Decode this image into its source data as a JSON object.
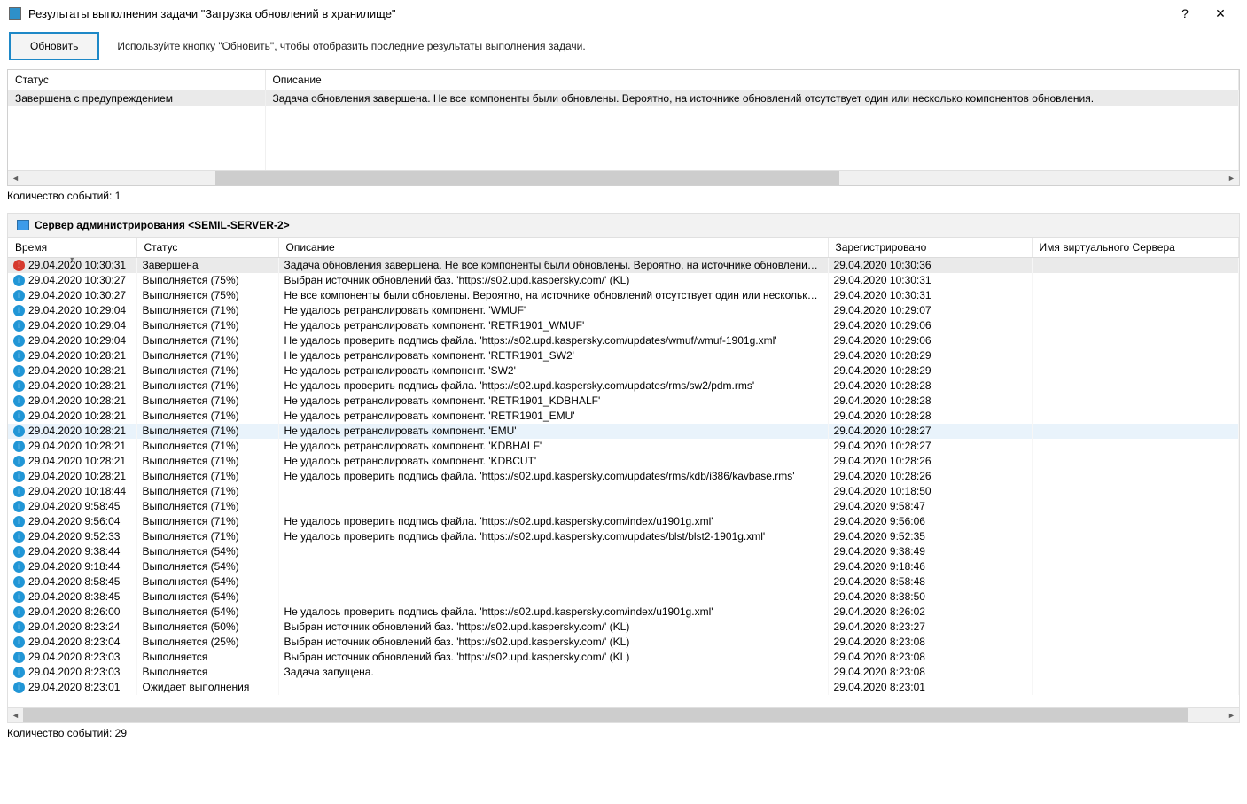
{
  "titlebar": {
    "title": "Результаты выполнения задачи \"Загрузка обновлений в хранилище\"",
    "help": "?",
    "close": "✕"
  },
  "toolbar": {
    "refresh_label": "Обновить",
    "hint": "Используйте кнопку \"Обновить\", чтобы отобразить последние результаты выполнения задачи."
  },
  "upper": {
    "cols": {
      "status": "Статус",
      "desc": "Описание"
    },
    "row": {
      "status": "Завершена с предупреждением",
      "desc": "Задача обновления завершена. Не все компоненты были обновлены. Вероятно, на источнике обновлений отсутствует один или несколько компонентов обновления."
    },
    "count": "Количество событий: 1"
  },
  "server": {
    "label_prefix": "Сервер администрирования ",
    "name": "<SEMIL-SERVER-2>"
  },
  "events": {
    "cols": {
      "time": "Время",
      "status": "Статус",
      "desc": "Описание",
      "registered": "Зарегистрировано",
      "vserver": "Имя виртуального Сервера"
    },
    "rows": [
      {
        "icon": "error",
        "time": "29.04.2020 10:30:31",
        "status": "Завершена",
        "desc": "Задача обновления завершена. Не все компоненты были обновлены. Вероятно, на источнике обновлений отсутствует...",
        "reg": "29.04.2020 10:30:36",
        "vs": "",
        "cls": "completed"
      },
      {
        "icon": "info",
        "time": "29.04.2020 10:30:27",
        "status": "Выполняется (75%)",
        "desc": "Выбран источник обновлений баз. 'https://s02.upd.kaspersky.com/' (KL)",
        "reg": "29.04.2020 10:30:31",
        "vs": ""
      },
      {
        "icon": "info",
        "time": "29.04.2020 10:30:27",
        "status": "Выполняется (75%)",
        "desc": "Не все компоненты были обновлены. Вероятно, на источнике обновлений отсутствует один или несколько компонент...",
        "reg": "29.04.2020 10:30:31",
        "vs": ""
      },
      {
        "icon": "info",
        "time": "29.04.2020 10:29:04",
        "status": "Выполняется (71%)",
        "desc": "Не удалось ретранслировать компонент. 'WMUF'",
        "reg": "29.04.2020 10:29:07",
        "vs": ""
      },
      {
        "icon": "info",
        "time": "29.04.2020 10:29:04",
        "status": "Выполняется (71%)",
        "desc": "Не удалось ретранслировать компонент. 'RETR1901_WMUF'",
        "reg": "29.04.2020 10:29:06",
        "vs": ""
      },
      {
        "icon": "info",
        "time": "29.04.2020 10:29:04",
        "status": "Выполняется (71%)",
        "desc": "Не удалось проверить подпись файла. 'https://s02.upd.kaspersky.com/updates/wmuf/wmuf-1901g.xml'",
        "reg": "29.04.2020 10:29:06",
        "vs": ""
      },
      {
        "icon": "info",
        "time": "29.04.2020 10:28:21",
        "status": "Выполняется (71%)",
        "desc": "Не удалось ретранслировать компонент. 'RETR1901_SW2'",
        "reg": "29.04.2020 10:28:29",
        "vs": ""
      },
      {
        "icon": "info",
        "time": "29.04.2020 10:28:21",
        "status": "Выполняется (71%)",
        "desc": "Не удалось ретранслировать компонент. 'SW2'",
        "reg": "29.04.2020 10:28:29",
        "vs": ""
      },
      {
        "icon": "info",
        "time": "29.04.2020 10:28:21",
        "status": "Выполняется (71%)",
        "desc": "Не удалось проверить подпись файла. 'https://s02.upd.kaspersky.com/updates/rms/sw2/pdm.rms'",
        "reg": "29.04.2020 10:28:28",
        "vs": ""
      },
      {
        "icon": "info",
        "time": "29.04.2020 10:28:21",
        "status": "Выполняется (71%)",
        "desc": "Не удалось ретранслировать компонент. 'RETR1901_KDBHALF'",
        "reg": "29.04.2020 10:28:28",
        "vs": ""
      },
      {
        "icon": "info",
        "time": "29.04.2020 10:28:21",
        "status": "Выполняется (71%)",
        "desc": "Не удалось ретранслировать компонент. 'RETR1901_EMU'",
        "reg": "29.04.2020 10:28:28",
        "vs": ""
      },
      {
        "icon": "info",
        "time": "29.04.2020 10:28:21",
        "status": "Выполняется (71%)",
        "desc": "Не удалось ретранслировать компонент. 'EMU'",
        "reg": "29.04.2020 10:28:27",
        "vs": "",
        "cls": "highlight"
      },
      {
        "icon": "info",
        "time": "29.04.2020 10:28:21",
        "status": "Выполняется (71%)",
        "desc": "Не удалось ретранслировать компонент. 'KDBHALF'",
        "reg": "29.04.2020 10:28:27",
        "vs": ""
      },
      {
        "icon": "info",
        "time": "29.04.2020 10:28:21",
        "status": "Выполняется (71%)",
        "desc": "Не удалось ретранслировать компонент. 'KDBCUT'",
        "reg": "29.04.2020 10:28:26",
        "vs": ""
      },
      {
        "icon": "info",
        "time": "29.04.2020 10:28:21",
        "status": "Выполняется (71%)",
        "desc": "Не удалось проверить подпись файла. 'https://s02.upd.kaspersky.com/updates/rms/kdb/i386/kavbase.rms'",
        "reg": "29.04.2020 10:28:26",
        "vs": ""
      },
      {
        "icon": "info",
        "time": "29.04.2020 10:18:44",
        "status": "Выполняется (71%)",
        "desc": "",
        "reg": "29.04.2020 10:18:50",
        "vs": ""
      },
      {
        "icon": "info",
        "time": "29.04.2020 9:58:45",
        "status": "Выполняется (71%)",
        "desc": "",
        "reg": "29.04.2020 9:58:47",
        "vs": ""
      },
      {
        "icon": "info",
        "time": "29.04.2020 9:56:04",
        "status": "Выполняется (71%)",
        "desc": "Не удалось проверить подпись файла. 'https://s02.upd.kaspersky.com/index/u1901g.xml'",
        "reg": "29.04.2020 9:56:06",
        "vs": ""
      },
      {
        "icon": "info",
        "time": "29.04.2020 9:52:33",
        "status": "Выполняется (71%)",
        "desc": "Не удалось проверить подпись файла. 'https://s02.upd.kaspersky.com/updates/blst/blst2-1901g.xml'",
        "reg": "29.04.2020 9:52:35",
        "vs": ""
      },
      {
        "icon": "info",
        "time": "29.04.2020 9:38:44",
        "status": "Выполняется (54%)",
        "desc": "",
        "reg": "29.04.2020 9:38:49",
        "vs": ""
      },
      {
        "icon": "info",
        "time": "29.04.2020 9:18:44",
        "status": "Выполняется (54%)",
        "desc": "",
        "reg": "29.04.2020 9:18:46",
        "vs": ""
      },
      {
        "icon": "info",
        "time": "29.04.2020 8:58:45",
        "status": "Выполняется (54%)",
        "desc": "",
        "reg": "29.04.2020 8:58:48",
        "vs": ""
      },
      {
        "icon": "info",
        "time": "29.04.2020 8:38:45",
        "status": "Выполняется (54%)",
        "desc": "",
        "reg": "29.04.2020 8:38:50",
        "vs": ""
      },
      {
        "icon": "info",
        "time": "29.04.2020 8:26:00",
        "status": "Выполняется (54%)",
        "desc": "Не удалось проверить подпись файла. 'https://s02.upd.kaspersky.com/index/u1901g.xml'",
        "reg": "29.04.2020 8:26:02",
        "vs": ""
      },
      {
        "icon": "info",
        "time": "29.04.2020 8:23:24",
        "status": "Выполняется (50%)",
        "desc": "Выбран источник обновлений баз. 'https://s02.upd.kaspersky.com/' (KL)",
        "reg": "29.04.2020 8:23:27",
        "vs": ""
      },
      {
        "icon": "info",
        "time": "29.04.2020 8:23:04",
        "status": "Выполняется (25%)",
        "desc": "Выбран источник обновлений баз. 'https://s02.upd.kaspersky.com/' (KL)",
        "reg": "29.04.2020 8:23:08",
        "vs": ""
      },
      {
        "icon": "info",
        "time": "29.04.2020 8:23:03",
        "status": "Выполняется",
        "desc": "Выбран источник обновлений баз. 'https://s02.upd.kaspersky.com/' (KL)",
        "reg": "29.04.2020 8:23:08",
        "vs": ""
      },
      {
        "icon": "info",
        "time": "29.04.2020 8:23:03",
        "status": "Выполняется",
        "desc": "Задача запущена.",
        "reg": "29.04.2020 8:23:08",
        "vs": ""
      },
      {
        "icon": "info",
        "time": "29.04.2020 8:23:01",
        "status": "Ожидает выполнения",
        "desc": "",
        "reg": "29.04.2020 8:23:01",
        "vs": ""
      }
    ],
    "count": "Количество событий: 29"
  }
}
